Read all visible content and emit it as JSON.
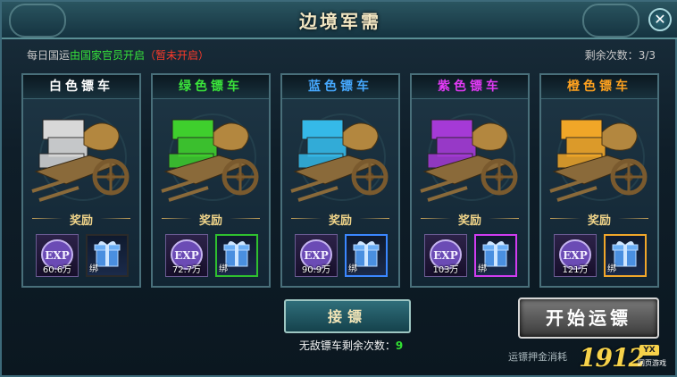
{
  "window": {
    "title": "边境军需",
    "close_label": "✕"
  },
  "info": {
    "prefix": "每日国运",
    "condition": "由国家官员开启",
    "status": "（暂未开启）",
    "remaining_label": "剩余次数：",
    "remaining_value": "3/3"
  },
  "carts": [
    {
      "name": "白色镖车",
      "color": "#ffffff",
      "box_color": "#d8d8d8",
      "reward_label": "奖励",
      "exp_amount": "60.6万",
      "item_bind": "绑",
      "item_border": "#2a2a2a"
    },
    {
      "name": "绿色镖车",
      "color": "#3be63b",
      "box_color": "#3fcf2d",
      "reward_label": "奖励",
      "exp_amount": "72.7万",
      "item_bind": "绑",
      "item_border": "#2fbf2f"
    },
    {
      "name": "蓝色镖车",
      "color": "#46a9ff",
      "box_color": "#35b9e8",
      "reward_label": "奖励",
      "exp_amount": "90.9万",
      "item_bind": "绑",
      "item_border": "#3b87ff"
    },
    {
      "name": "紫色镖车",
      "color": "#e23af5",
      "box_color": "#a53ad6",
      "reward_label": "奖励",
      "exp_amount": "103万",
      "item_bind": "绑",
      "item_border": "#d03cf0"
    },
    {
      "name": "橙色镖车",
      "color": "#ffa21f",
      "box_color": "#f0a628",
      "reward_label": "奖励",
      "exp_amount": "121万",
      "item_bind": "绑",
      "item_border": "#f0a62a"
    }
  ],
  "actions": {
    "accept_label": "接镖",
    "invincible_label": "无敌镖车剩余次数：",
    "invincible_value": "9",
    "start_label": "开始运镖",
    "deposit_label": "运镖押金消耗"
  },
  "logo": {
    "number": "1912",
    "badge": "YX",
    "subtitle": "网页游戏"
  }
}
